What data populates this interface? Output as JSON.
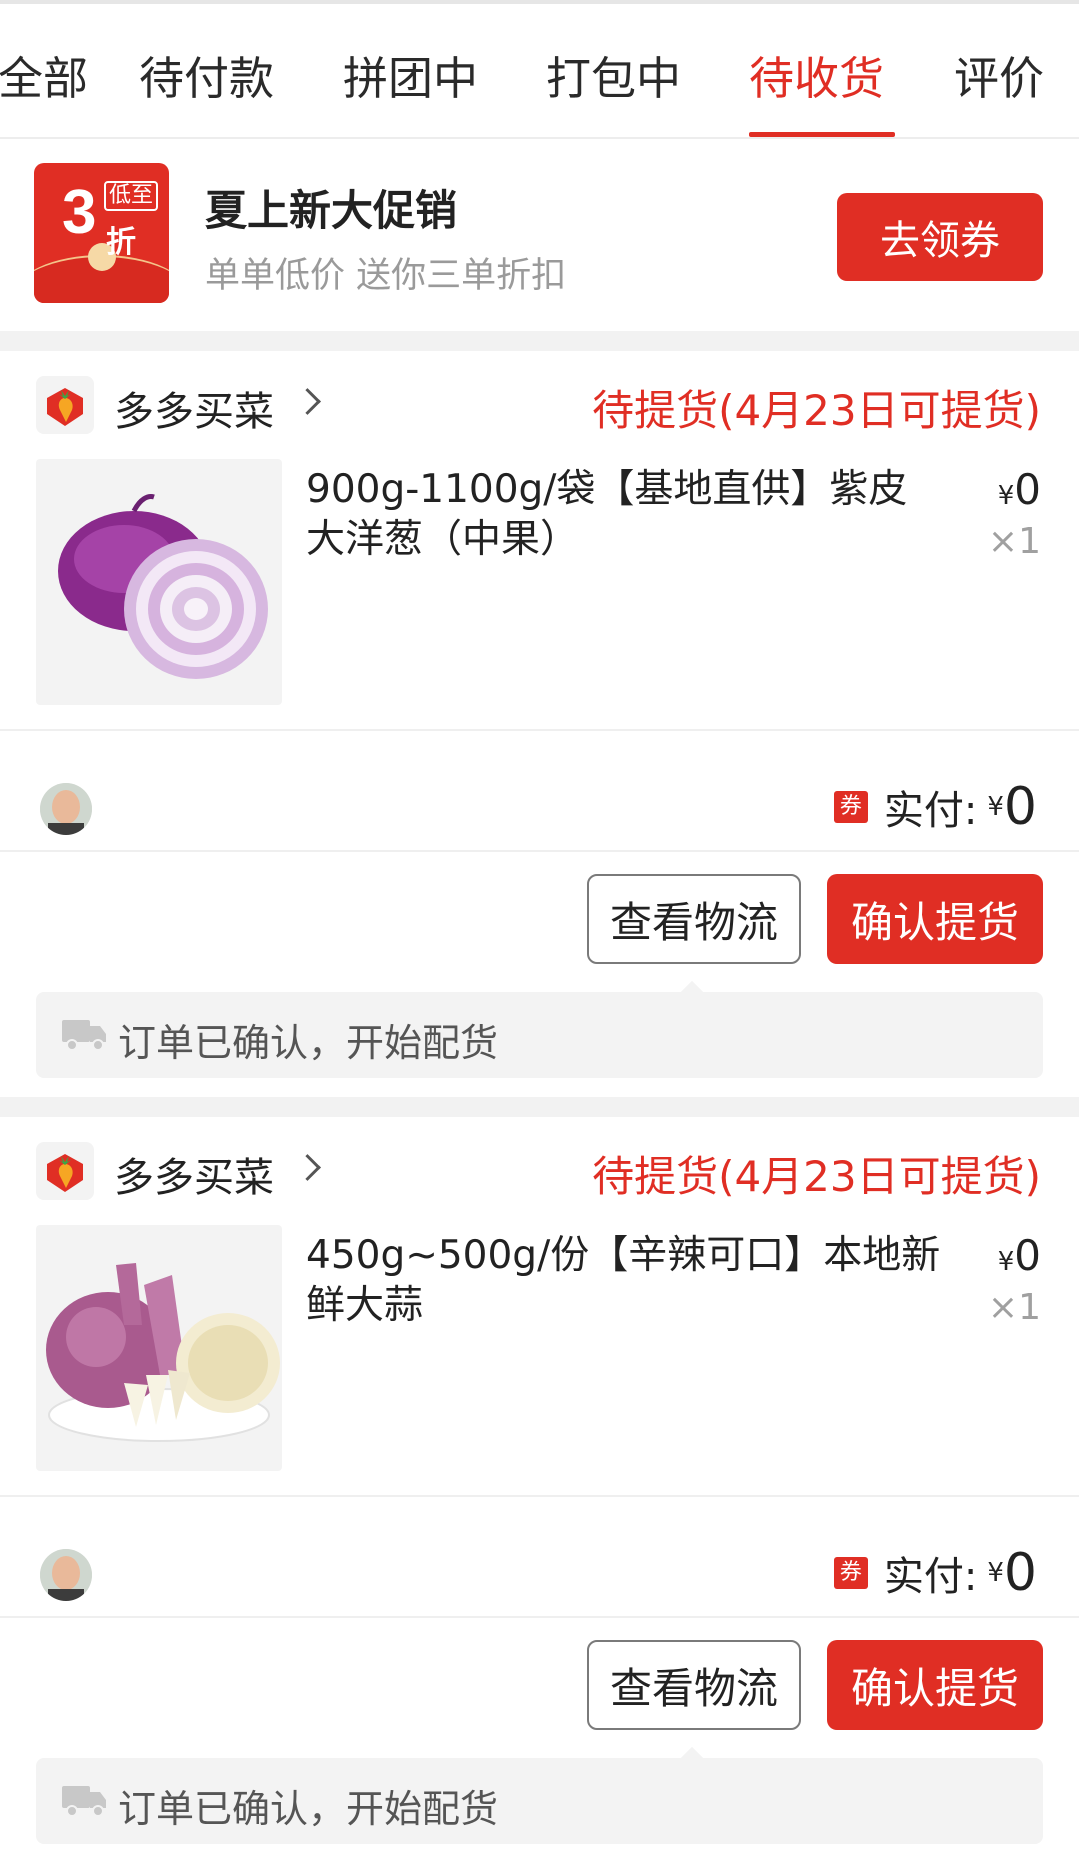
{
  "tabs": [
    {
      "label": "全部"
    },
    {
      "label": "待付款"
    },
    {
      "label": "拼团中"
    },
    {
      "label": "打包中"
    },
    {
      "label": "待收货"
    },
    {
      "label": "评价"
    }
  ],
  "active_tab_index": 4,
  "promo": {
    "badge_number": "3",
    "badge_unit": "折",
    "badge_tag": "低至",
    "title": "夏上新大促销",
    "subtitle": "单单低价 送你三单折扣",
    "button": "去领券"
  },
  "orders": [
    {
      "shop": "多多买菜",
      "status": "待提货(4月23日可提货)",
      "product_title": "900g-1100g/袋【基地直供】紫皮大洋葱（中果）",
      "product_image": "red-onion",
      "price_symbol": "¥",
      "price": "0",
      "qty": "×1",
      "coupon": "券",
      "paid_label": "实付:",
      "paid_symbol": "¥",
      "paid_amount": "0",
      "btn_logistics": "查看物流",
      "btn_confirm": "确认提货",
      "tip": "订单已确认，开始配货"
    },
    {
      "shop": "多多买菜",
      "status": "待提货(4月23日可提货)",
      "product_title": "450g~500g/份【辛辣可口】本地新鲜大蒜",
      "product_image": "garlic",
      "price_symbol": "¥",
      "price": "0",
      "qty": "×1",
      "coupon": "券",
      "paid_label": "实付:",
      "paid_symbol": "¥",
      "paid_amount": "0",
      "btn_logistics": "查看物流",
      "btn_confirm": "确认提货",
      "tip": "订单已确认，开始配货"
    }
  ],
  "colors": {
    "accent": "#e02e24",
    "muted": "#9a9a9a",
    "divider": "#efefef",
    "tip_bg": "#f3f3f3"
  }
}
